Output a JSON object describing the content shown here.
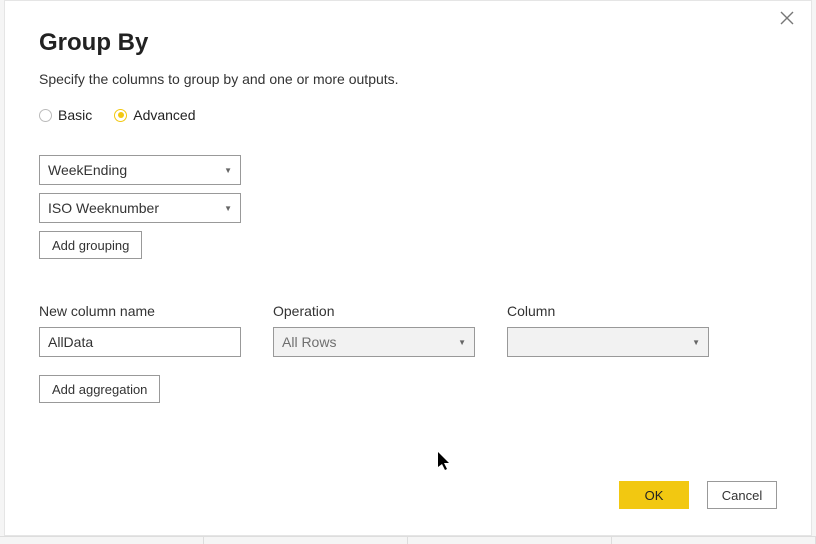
{
  "dialog": {
    "title": "Group By",
    "subtitle": "Specify the columns to group by and one or more outputs."
  },
  "mode": {
    "basic_label": "Basic",
    "advanced_label": "Advanced",
    "selected": "advanced"
  },
  "grouping": {
    "columns": [
      "WeekEnding",
      "ISO Weeknumber"
    ],
    "add_label": "Add grouping"
  },
  "aggregations": {
    "headers": {
      "name": "New column name",
      "operation": "Operation",
      "column": "Column"
    },
    "rows": [
      {
        "name": "AllData",
        "operation": "All Rows",
        "column": ""
      }
    ],
    "add_label": "Add aggregation"
  },
  "buttons": {
    "ok": "OK",
    "cancel": "Cancel"
  }
}
